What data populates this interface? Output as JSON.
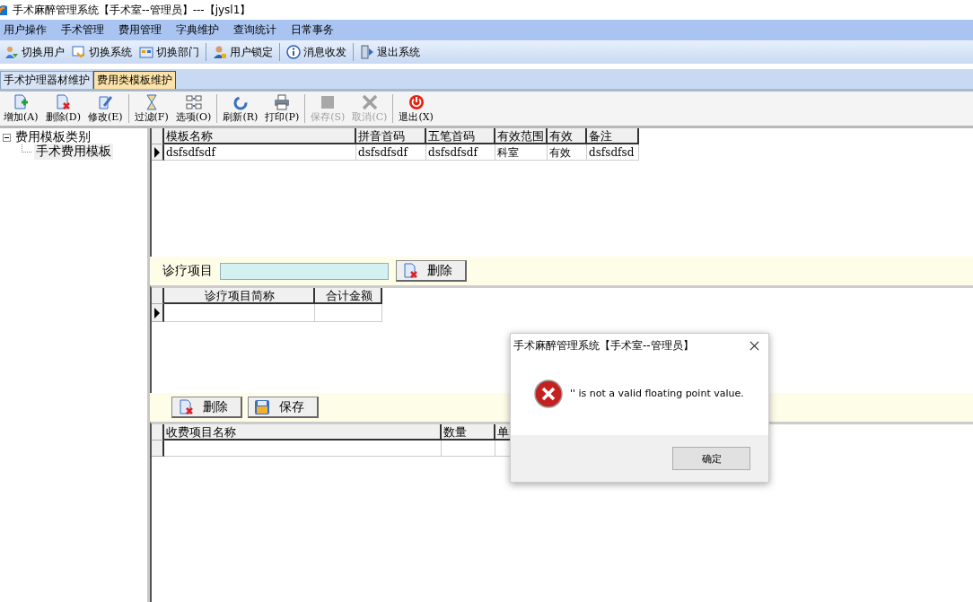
{
  "window": {
    "title": "手术麻醉管理系统【手术室--管理员】---【jysl1】"
  },
  "menu": [
    "用户操作",
    "手术管理",
    "费用管理",
    "字典维护",
    "查询统计",
    "日常事务"
  ],
  "quickbar": [
    [
      {
        "kind": "users",
        "label": "切换用户"
      },
      {
        "kind": "system",
        "label": "切换系统"
      },
      {
        "kind": "dept",
        "label": "切换部门"
      }
    ],
    [
      {
        "kind": "lock",
        "label": "用户锁定"
      }
    ],
    [
      {
        "kind": "info",
        "label": "消息收发"
      }
    ],
    [
      {
        "kind": "exit",
        "label": "退出系统"
      }
    ]
  ],
  "tabs": [
    {
      "label": "手术护理器材维护",
      "selected": false
    },
    {
      "label": "费用类模板维护",
      "selected": true
    }
  ],
  "toolbar": [
    [
      {
        "kind": "add",
        "label": "增加(A)",
        "disabled": false
      },
      {
        "kind": "delete",
        "label": "删除(D)",
        "disabled": false
      },
      {
        "kind": "edit",
        "label": "修改(E)",
        "disabled": false
      }
    ],
    [
      {
        "kind": "filter",
        "label": "过滤(F)",
        "disabled": false
      },
      {
        "kind": "options",
        "label": "选项(O)",
        "disabled": false
      }
    ],
    [
      {
        "kind": "refresh",
        "label": "刷新(R)",
        "disabled": false
      },
      {
        "kind": "print",
        "label": "打印(P)",
        "disabled": false
      }
    ],
    [
      {
        "kind": "save",
        "label": "保存(S)",
        "disabled": true
      },
      {
        "kind": "cancel",
        "label": "取消(C)",
        "disabled": true
      }
    ],
    [
      {
        "kind": "power",
        "label": "退出(X)",
        "disabled": false
      }
    ]
  ],
  "tree": [
    {
      "label": "费用模板类别",
      "expanded": true,
      "selected": false,
      "children": [
        {
          "label": "手术费用模板",
          "selected": true
        }
      ]
    }
  ],
  "template_grid": {
    "columns": [
      "模板名称",
      "拼音首码",
      "五笔首码",
      "有效范围",
      "有效",
      "备注"
    ],
    "rows": [
      {
        "current": true,
        "cells": [
          "dsfsdfsdf",
          "dsfsdfsdf",
          "dsfsdfsdf",
          "科室",
          "有效",
          "dsfsdfsd"
        ]
      }
    ]
  },
  "item_filter": {
    "label": "诊疗项目",
    "button": "删除"
  },
  "item_grid": {
    "columns": [
      "诊疗项目简称",
      "合计金额"
    ],
    "rows": [
      {
        "current": true
      }
    ]
  },
  "item_actions": [
    {
      "kind": "delete",
      "label": "删除"
    },
    {
      "kind": "save",
      "label": "保存"
    }
  ],
  "charge_grid": {
    "columns": [
      "收费项目名称",
      "数量",
      "单"
    ],
    "rows": [
      {
        "current": false
      }
    ]
  },
  "dialog": {
    "title": "手术麻醉管理系统【手术室--管理员】",
    "message": "'' is not a valid floating point value.",
    "button": "确定"
  }
}
